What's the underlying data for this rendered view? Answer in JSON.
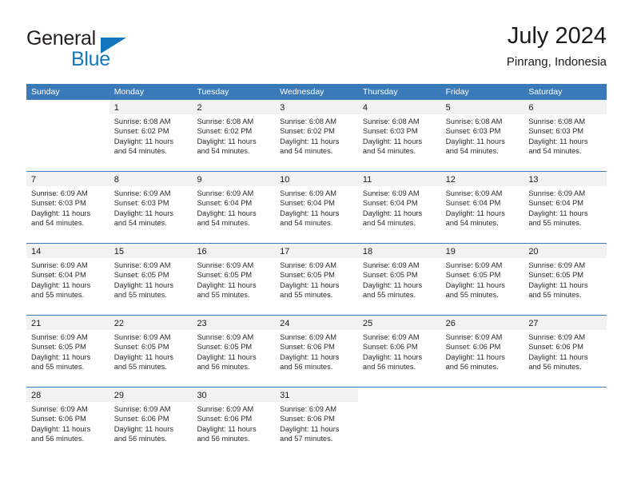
{
  "brand": {
    "name_part1": "General",
    "name_part2": "Blue",
    "triangle_color": "#1277bc",
    "text_color": "#231f20"
  },
  "header": {
    "title": "July 2024",
    "subtitle": "Pinrang, Indonesia",
    "accent_color": "#3a7ab8",
    "band_color": "#f2f2f2"
  },
  "weekday_headers": [
    "Sunday",
    "Monday",
    "Tuesday",
    "Wednesday",
    "Thursday",
    "Friday",
    "Saturday"
  ],
  "weeks": [
    [
      {
        "day": "",
        "sunrise": "",
        "sunset": "",
        "daylight_line1": "",
        "daylight_line2": ""
      },
      {
        "day": "1",
        "sunrise": "Sunrise: 6:08 AM",
        "sunset": "Sunset: 6:02 PM",
        "daylight_line1": "Daylight: 11 hours",
        "daylight_line2": "and 54 minutes."
      },
      {
        "day": "2",
        "sunrise": "Sunrise: 6:08 AM",
        "sunset": "Sunset: 6:02 PM",
        "daylight_line1": "Daylight: 11 hours",
        "daylight_line2": "and 54 minutes."
      },
      {
        "day": "3",
        "sunrise": "Sunrise: 6:08 AM",
        "sunset": "Sunset: 6:02 PM",
        "daylight_line1": "Daylight: 11 hours",
        "daylight_line2": "and 54 minutes."
      },
      {
        "day": "4",
        "sunrise": "Sunrise: 6:08 AM",
        "sunset": "Sunset: 6:03 PM",
        "daylight_line1": "Daylight: 11 hours",
        "daylight_line2": "and 54 minutes."
      },
      {
        "day": "5",
        "sunrise": "Sunrise: 6:08 AM",
        "sunset": "Sunset: 6:03 PM",
        "daylight_line1": "Daylight: 11 hours",
        "daylight_line2": "and 54 minutes."
      },
      {
        "day": "6",
        "sunrise": "Sunrise: 6:08 AM",
        "sunset": "Sunset: 6:03 PM",
        "daylight_line1": "Daylight: 11 hours",
        "daylight_line2": "and 54 minutes."
      }
    ],
    [
      {
        "day": "7",
        "sunrise": "Sunrise: 6:09 AM",
        "sunset": "Sunset: 6:03 PM",
        "daylight_line1": "Daylight: 11 hours",
        "daylight_line2": "and 54 minutes."
      },
      {
        "day": "8",
        "sunrise": "Sunrise: 6:09 AM",
        "sunset": "Sunset: 6:03 PM",
        "daylight_line1": "Daylight: 11 hours",
        "daylight_line2": "and 54 minutes."
      },
      {
        "day": "9",
        "sunrise": "Sunrise: 6:09 AM",
        "sunset": "Sunset: 6:04 PM",
        "daylight_line1": "Daylight: 11 hours",
        "daylight_line2": "and 54 minutes."
      },
      {
        "day": "10",
        "sunrise": "Sunrise: 6:09 AM",
        "sunset": "Sunset: 6:04 PM",
        "daylight_line1": "Daylight: 11 hours",
        "daylight_line2": "and 54 minutes."
      },
      {
        "day": "11",
        "sunrise": "Sunrise: 6:09 AM",
        "sunset": "Sunset: 6:04 PM",
        "daylight_line1": "Daylight: 11 hours",
        "daylight_line2": "and 54 minutes."
      },
      {
        "day": "12",
        "sunrise": "Sunrise: 6:09 AM",
        "sunset": "Sunset: 6:04 PM",
        "daylight_line1": "Daylight: 11 hours",
        "daylight_line2": "and 54 minutes."
      },
      {
        "day": "13",
        "sunrise": "Sunrise: 6:09 AM",
        "sunset": "Sunset: 6:04 PM",
        "daylight_line1": "Daylight: 11 hours",
        "daylight_line2": "and 55 minutes."
      }
    ],
    [
      {
        "day": "14",
        "sunrise": "Sunrise: 6:09 AM",
        "sunset": "Sunset: 6:04 PM",
        "daylight_line1": "Daylight: 11 hours",
        "daylight_line2": "and 55 minutes."
      },
      {
        "day": "15",
        "sunrise": "Sunrise: 6:09 AM",
        "sunset": "Sunset: 6:05 PM",
        "daylight_line1": "Daylight: 11 hours",
        "daylight_line2": "and 55 minutes."
      },
      {
        "day": "16",
        "sunrise": "Sunrise: 6:09 AM",
        "sunset": "Sunset: 6:05 PM",
        "daylight_line1": "Daylight: 11 hours",
        "daylight_line2": "and 55 minutes."
      },
      {
        "day": "17",
        "sunrise": "Sunrise: 6:09 AM",
        "sunset": "Sunset: 6:05 PM",
        "daylight_line1": "Daylight: 11 hours",
        "daylight_line2": "and 55 minutes."
      },
      {
        "day": "18",
        "sunrise": "Sunrise: 6:09 AM",
        "sunset": "Sunset: 6:05 PM",
        "daylight_line1": "Daylight: 11 hours",
        "daylight_line2": "and 55 minutes."
      },
      {
        "day": "19",
        "sunrise": "Sunrise: 6:09 AM",
        "sunset": "Sunset: 6:05 PM",
        "daylight_line1": "Daylight: 11 hours",
        "daylight_line2": "and 55 minutes."
      },
      {
        "day": "20",
        "sunrise": "Sunrise: 6:09 AM",
        "sunset": "Sunset: 6:05 PM",
        "daylight_line1": "Daylight: 11 hours",
        "daylight_line2": "and 55 minutes."
      }
    ],
    [
      {
        "day": "21",
        "sunrise": "Sunrise: 6:09 AM",
        "sunset": "Sunset: 6:05 PM",
        "daylight_line1": "Daylight: 11 hours",
        "daylight_line2": "and 55 minutes."
      },
      {
        "day": "22",
        "sunrise": "Sunrise: 6:09 AM",
        "sunset": "Sunset: 6:05 PM",
        "daylight_line1": "Daylight: 11 hours",
        "daylight_line2": "and 55 minutes."
      },
      {
        "day": "23",
        "sunrise": "Sunrise: 6:09 AM",
        "sunset": "Sunset: 6:05 PM",
        "daylight_line1": "Daylight: 11 hours",
        "daylight_line2": "and 56 minutes."
      },
      {
        "day": "24",
        "sunrise": "Sunrise: 6:09 AM",
        "sunset": "Sunset: 6:06 PM",
        "daylight_line1": "Daylight: 11 hours",
        "daylight_line2": "and 56 minutes."
      },
      {
        "day": "25",
        "sunrise": "Sunrise: 6:09 AM",
        "sunset": "Sunset: 6:06 PM",
        "daylight_line1": "Daylight: 11 hours",
        "daylight_line2": "and 56 minutes."
      },
      {
        "day": "26",
        "sunrise": "Sunrise: 6:09 AM",
        "sunset": "Sunset: 6:06 PM",
        "daylight_line1": "Daylight: 11 hours",
        "daylight_line2": "and 56 minutes."
      },
      {
        "day": "27",
        "sunrise": "Sunrise: 6:09 AM",
        "sunset": "Sunset: 6:06 PM",
        "daylight_line1": "Daylight: 11 hours",
        "daylight_line2": "and 56 minutes."
      }
    ],
    [
      {
        "day": "28",
        "sunrise": "Sunrise: 6:09 AM",
        "sunset": "Sunset: 6:06 PM",
        "daylight_line1": "Daylight: 11 hours",
        "daylight_line2": "and 56 minutes."
      },
      {
        "day": "29",
        "sunrise": "Sunrise: 6:09 AM",
        "sunset": "Sunset: 6:06 PM",
        "daylight_line1": "Daylight: 11 hours",
        "daylight_line2": "and 56 minutes."
      },
      {
        "day": "30",
        "sunrise": "Sunrise: 6:09 AM",
        "sunset": "Sunset: 6:06 PM",
        "daylight_line1": "Daylight: 11 hours",
        "daylight_line2": "and 56 minutes."
      },
      {
        "day": "31",
        "sunrise": "Sunrise: 6:09 AM",
        "sunset": "Sunset: 6:06 PM",
        "daylight_line1": "Daylight: 11 hours",
        "daylight_line2": "and 57 minutes."
      },
      {
        "day": "",
        "sunrise": "",
        "sunset": "",
        "daylight_line1": "",
        "daylight_line2": ""
      },
      {
        "day": "",
        "sunrise": "",
        "sunset": "",
        "daylight_line1": "",
        "daylight_line2": ""
      },
      {
        "day": "",
        "sunrise": "",
        "sunset": "",
        "daylight_line1": "",
        "daylight_line2": ""
      }
    ]
  ]
}
